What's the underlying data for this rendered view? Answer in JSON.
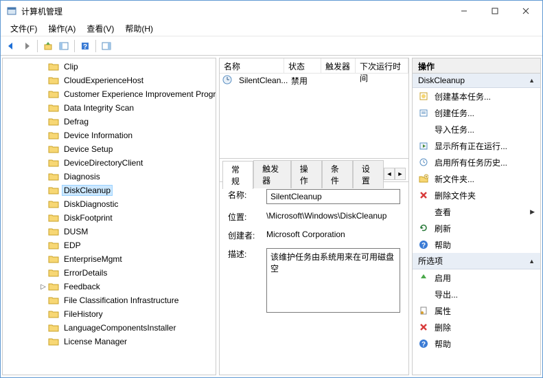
{
  "titlebar": {
    "title": "计算机管理"
  },
  "menu": [
    "文件(F)",
    "操作(A)",
    "查看(V)",
    "帮助(H)"
  ],
  "tree": [
    {
      "label": "Clip"
    },
    {
      "label": "CloudExperienceHost"
    },
    {
      "label": "Customer Experience Improvement Program"
    },
    {
      "label": "Data Integrity Scan"
    },
    {
      "label": "Defrag"
    },
    {
      "label": "Device Information"
    },
    {
      "label": "Device Setup"
    },
    {
      "label": "DeviceDirectoryClient"
    },
    {
      "label": "Diagnosis"
    },
    {
      "label": "DiskCleanup",
      "selected": true
    },
    {
      "label": "DiskDiagnostic"
    },
    {
      "label": "DiskFootprint"
    },
    {
      "label": "DUSM"
    },
    {
      "label": "EDP"
    },
    {
      "label": "EnterpriseMgmt"
    },
    {
      "label": "ErrorDetails"
    },
    {
      "label": "Feedback",
      "expandable": true
    },
    {
      "label": "File Classification Infrastructure"
    },
    {
      "label": "FileHistory"
    },
    {
      "label": "LanguageComponentsInstaller"
    },
    {
      "label": "License Manager"
    }
  ],
  "list": {
    "headers": [
      "名称",
      "状态",
      "触发器",
      "下次运行时间"
    ],
    "rows": [
      {
        "name": "SilentClean...",
        "status": "禁用"
      }
    ]
  },
  "tabs": [
    "常规",
    "触发器",
    "操作",
    "条件",
    "设置"
  ],
  "details": {
    "name_label": "名称:",
    "name_value": "SilentCleanup",
    "location_label": "位置:",
    "location_value": "\\Microsoft\\Windows\\DiskCleanup",
    "author_label": "创建者:",
    "author_value": "Microsoft Corporation",
    "desc_label": "描述:",
    "desc_value": "该维护任务由系统用来在可用磁盘空"
  },
  "actions": {
    "header": "操作",
    "section1": "DiskCleanup",
    "items1": [
      {
        "icon": "task-basic",
        "label": "创建基本任务..."
      },
      {
        "icon": "task",
        "label": "创建任务..."
      },
      {
        "icon": "import",
        "label": "导入任务..."
      },
      {
        "icon": "running",
        "label": "显示所有正在运行..."
      },
      {
        "icon": "history",
        "label": "启用所有任务历史..."
      },
      {
        "icon": "newfolder",
        "label": "新文件夹..."
      },
      {
        "icon": "delete-red",
        "label": "删除文件夹"
      },
      {
        "icon": "view",
        "label": "查看",
        "sub": "▶"
      },
      {
        "icon": "refresh",
        "label": "刷新"
      },
      {
        "icon": "help",
        "label": "帮助"
      }
    ],
    "section2": "所选项",
    "items2": [
      {
        "icon": "enable",
        "label": "启用"
      },
      {
        "icon": "export",
        "label": "导出..."
      },
      {
        "icon": "props",
        "label": "属性"
      },
      {
        "icon": "delete-red",
        "label": "删除"
      },
      {
        "icon": "help",
        "label": "帮助"
      }
    ]
  }
}
